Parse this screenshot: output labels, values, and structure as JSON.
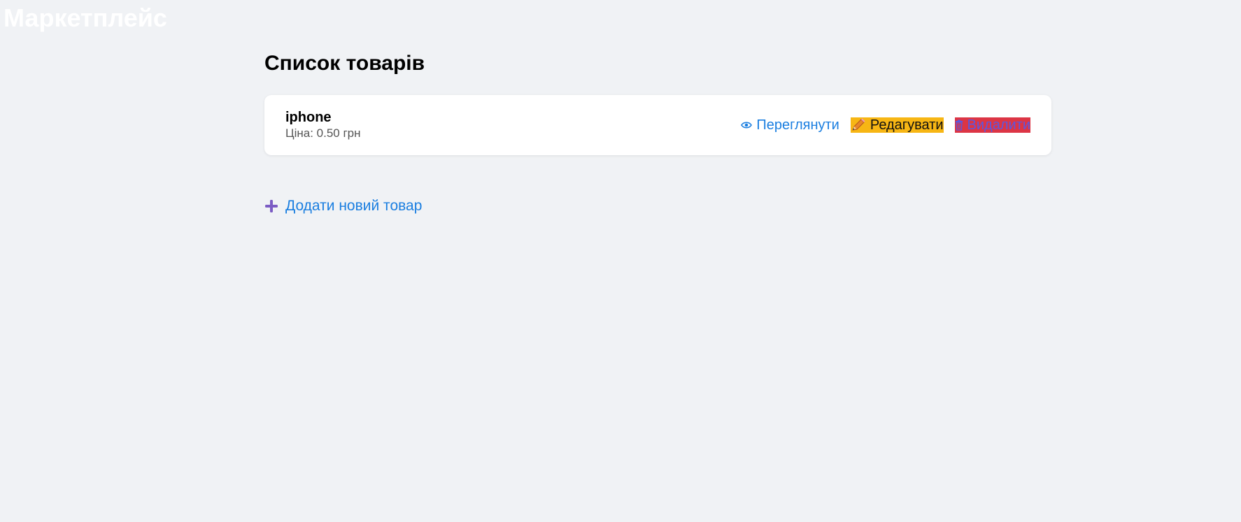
{
  "header": {
    "brand": "Маркетплейс"
  },
  "main": {
    "title": "Список товарів",
    "products": [
      {
        "name": "iphone",
        "price": "Ціна: 0.50 грн",
        "actions": {
          "view": "Переглянути",
          "edit": "Редагувати",
          "delete": "Видалити"
        }
      }
    ],
    "add_link": "Додати новий товар"
  },
  "icons": {
    "view": "eye-icon",
    "edit": "pencil-icon",
    "delete": "trash-icon",
    "add": "plus-icon"
  },
  "colors": {
    "background": "#f0f2f5",
    "link": "#1a7ee0",
    "edit_bg": "#f7b614",
    "delete_bg": "#dc3545",
    "plus": "#7b5cc4"
  }
}
